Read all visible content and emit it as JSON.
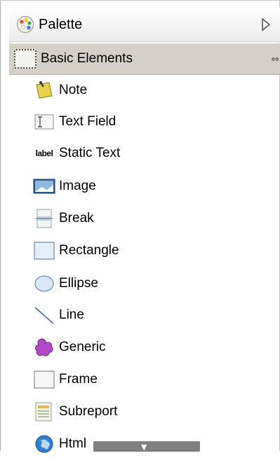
{
  "palette": {
    "title": "Palette"
  },
  "group": {
    "title": "Basic Elements",
    "arrows": "⇔"
  },
  "items": [
    {
      "label": "Note",
      "icon": "note-icon"
    },
    {
      "label": "Text Field",
      "icon": "text-field-icon"
    },
    {
      "label": "Static Text",
      "icon": "static-text-icon",
      "icon_text": "label"
    },
    {
      "label": "Image",
      "icon": "image-icon"
    },
    {
      "label": "Break",
      "icon": "break-icon"
    },
    {
      "label": "Rectangle",
      "icon": "rectangle-icon"
    },
    {
      "label": "Ellipse",
      "icon": "ellipse-icon"
    },
    {
      "label": "Line",
      "icon": "line-icon"
    },
    {
      "label": "Generic",
      "icon": "generic-icon"
    },
    {
      "label": "Frame",
      "icon": "frame-icon"
    },
    {
      "label": "Subreport",
      "icon": "subreport-icon"
    },
    {
      "label": "Html",
      "icon": "html-icon"
    }
  ],
  "colors": {
    "group_header": "#d4d0c8",
    "scrollbar": "#808080"
  }
}
